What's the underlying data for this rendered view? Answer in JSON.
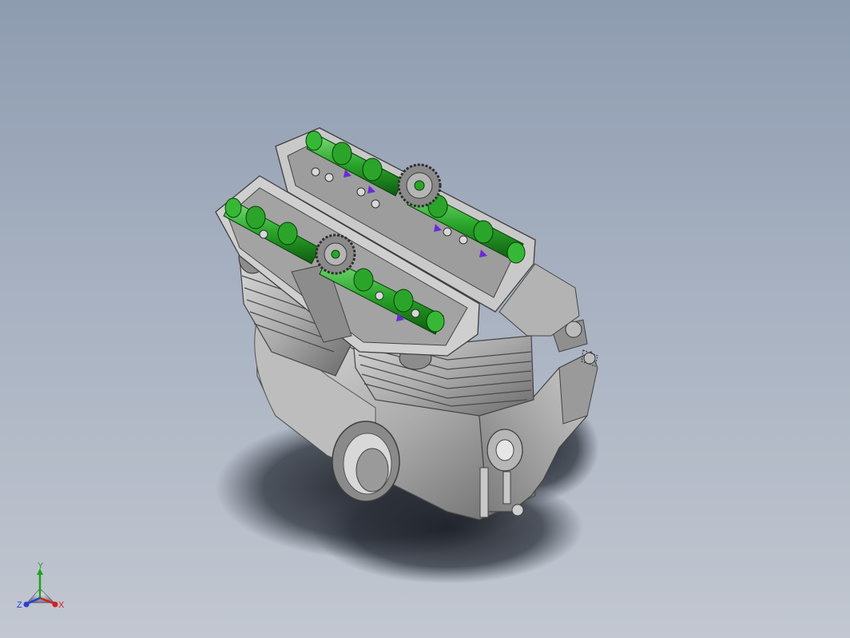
{
  "viewport": {
    "background_top": "#8e9cb0",
    "background_bottom": "#c2c7d0"
  },
  "model": {
    "icon": "engine-assembly",
    "colors": {
      "metal": "#a9a9a9",
      "metal_dark": "#5c5c5c",
      "camshaft": "#2aa52a",
      "camshaft_dark": "#106010",
      "accent": "#6a2bd6",
      "shadow": "#2a2f38"
    }
  },
  "triad": {
    "y_label": "Y",
    "z_label": "Z",
    "x_label": "X",
    "y_color": "#1aa51a",
    "x_color": "#d42020",
    "z_color": "#2a3fd8"
  }
}
